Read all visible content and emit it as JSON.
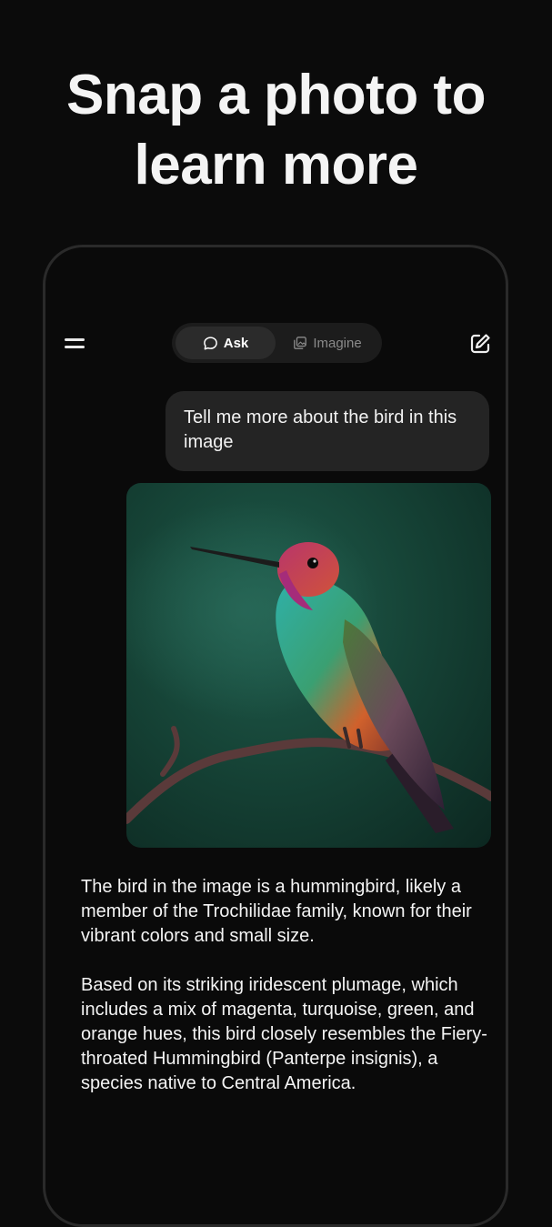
{
  "headline": "Snap a photo to learn more",
  "header": {
    "menu_icon": "menu-icon",
    "tabs": [
      {
        "label": "Ask",
        "icon": "chat-bubble-icon",
        "active": true
      },
      {
        "label": "Imagine",
        "icon": "image-stack-icon",
        "active": false
      }
    ],
    "new_chat_icon": "edit-icon"
  },
  "chat": {
    "user_message": "Tell me more about the bird in this image",
    "image_subject": "hummingbird",
    "response_paragraphs": [
      "The bird in the image is a hummingbird, likely a member of the Trochilidae family, known for their vibrant colors and small size.",
      "Based on its striking iridescent plumage, which includes a mix of magenta, turquoise, green, and orange hues, this bird closely resembles the Fiery-throated Hummingbird (Panterpe insignis), a species native to Central America."
    ]
  },
  "colors": {
    "background": "#0b0b0b",
    "bubble": "#242424",
    "toggle_bg": "#1c1c1c",
    "toggle_active": "#2b2b2b",
    "text": "#f4f4f4",
    "muted": "#8a8a8a"
  }
}
